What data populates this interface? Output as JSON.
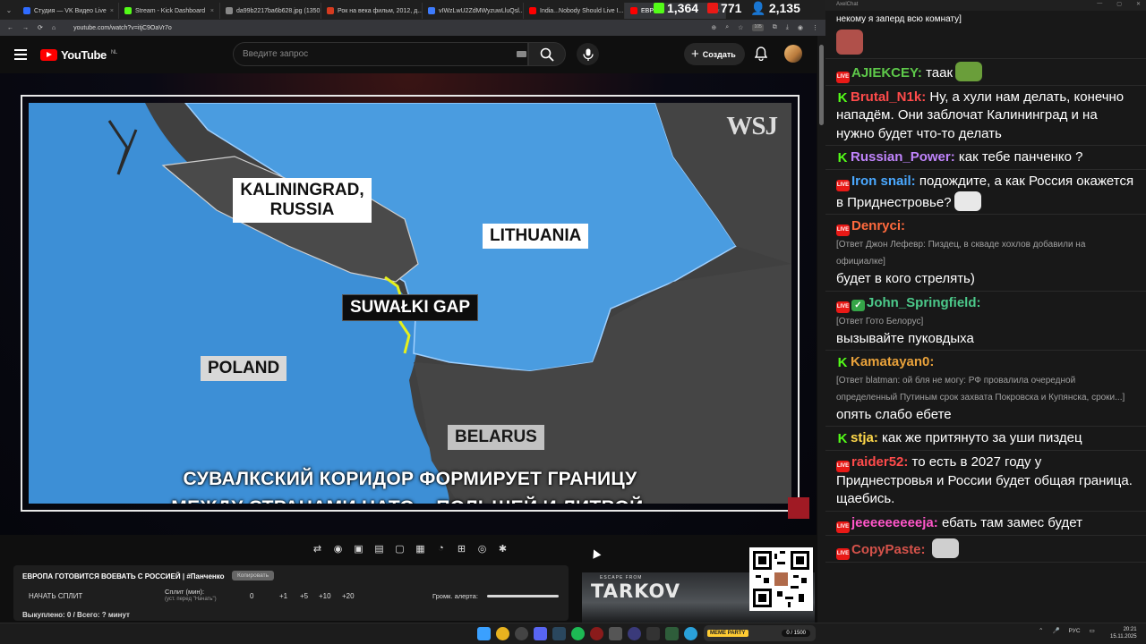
{
  "browser": {
    "tabs": [
      {
        "title": "Студия — VK Видео Live",
        "favcolor": "#2f6bff"
      },
      {
        "title": "Stream - Kick Dashboard",
        "favcolor": "#53fc18"
      },
      {
        "title": "da99b2217ba6b628.jpg (1350...",
        "favcolor": "#888888"
      },
      {
        "title": "Рок на века фильм, 2012, д...",
        "favcolor": "#d63b1f"
      },
      {
        "title": "vIWzLwU2ZdMWyzuwLluQsl...",
        "favcolor": "#3d7bfd"
      },
      {
        "title": "India...Nobody Should Live I...",
        "favcolor": "#ff0000"
      },
      {
        "title": "ЕВРО",
        "favcolor": "#ff0000"
      }
    ],
    "url": "youtube.com/watch?v=itjC9OaVr7o",
    "ext_badge": "105"
  },
  "counters": {
    "kick": "1,364",
    "vk": "771",
    "users": "2,135"
  },
  "youtube": {
    "logo_text": "YouTube",
    "region": "NL",
    "search_placeholder": "Введите запрос",
    "create_label": "Создать"
  },
  "video": {
    "watermark": "WSJ",
    "labels": {
      "kaliningrad": "KALININGRAD,\nRUSSIA",
      "lithuania": "LITHUANIA",
      "suwalki": "SUWAŁKI GAP",
      "poland": "POLAND",
      "belarus": "BELARUS"
    },
    "subtitle_line1": "СУВАЛКСКИЙ КОРИДОР ФОРМИРУЕТ ГРАНИЦУ",
    "subtitle_line2": "МЕЖДУ СТРАНАМИ НАТО – ПОЛЬШЕЙ И ЛИТВОЙ,"
  },
  "split": {
    "title": "ЕВРОПА ГОТОВИТСЯ ВОЕВАТЬ С РОССИЕЙ | #Панченко",
    "copy_label": "Копировать",
    "start_label": "НАЧАТЬ СПЛИТ",
    "split_label": "Сплит (мин):",
    "split_hint": "(уст. перед \"Начать\")",
    "value": "0",
    "increments": [
      "+1",
      "+5",
      "+10",
      "+20"
    ],
    "alert_label": "Громк. алерта:",
    "bought": "Выкуплено: 0 / Всего: ? минут"
  },
  "ad": {
    "subtitle": "ESCAPE FROM",
    "title": "TARKOV"
  },
  "taskbar": {
    "party_label": "MEME PARTY",
    "party_stat": "0 / 1500",
    "lang": "РУС",
    "time": "20:21",
    "date": "15.11.2025"
  },
  "chat": {
    "window_title": "AxelChat",
    "messages": [
      {
        "platform": "none",
        "user": "",
        "color": "#ffffff",
        "reply": "",
        "text": "некому я заперд всю комнату]",
        "emote": ""
      },
      {
        "platform": "none",
        "user": "",
        "color": "#ffffff",
        "reply": "",
        "text": "",
        "emote": "avatar"
      },
      {
        "platform": "vk",
        "user": "AJIEKCEY:",
        "color": "#5ec94a",
        "reply": "",
        "text": "таак",
        "emote": "frog"
      },
      {
        "platform": "kick",
        "user": "Brutal_N1k:",
        "color": "#ff4b4b",
        "reply": "",
        "text": "Ну, а хули нам делать, конечно нападём. Они заблочат Калининград и на нужно будет что-то делать",
        "emote": ""
      },
      {
        "platform": "kick",
        "user": "Russian_Power:",
        "color": "#c084fc",
        "reply": "",
        "text": "как тебе панченко ?",
        "emote": ""
      },
      {
        "platform": "vk",
        "user": "Iron snail:",
        "color": "#4aa8ff",
        "reply": "",
        "text": "подождите, а как Россия окажется в Приднестровье?",
        "emote": "pepe"
      },
      {
        "platform": "vk",
        "user": "Denryci:",
        "color": "#ff6a3d",
        "reply": "[Ответ Джон Лефевр: Пиздец, в скваде хохлов добавили на официалке]",
        "text": "будет в кого стрелять)",
        "emote": ""
      },
      {
        "platform": "vk-green",
        "user": "John_Springfield:",
        "color": "#4cc98a",
        "reply": "[Ответ Гото Белорус]",
        "text": "вызывайте пуковдыха",
        "emote": ""
      },
      {
        "platform": "kick",
        "user": "Kamatayan0:",
        "color": "#e9a23b",
        "reply": "[Ответ blatman: ой бля не могу: РФ провалила очередной определенный Путиным срок захвата Покровска и Купянска, сроки...]",
        "text": "опять слабо ебете",
        "emote": ""
      },
      {
        "platform": "kick",
        "user": "stja:",
        "color": "#ffd84a",
        "reply": "",
        "text": "как же притянуто за уши пиздец",
        "emote": ""
      },
      {
        "platform": "vk",
        "user": "raider52:",
        "color": "#ff4b4b",
        "reply": "",
        "text": "то есть в 2027 году у Приднестровья и России будет общая граница. щаебись.",
        "emote": ""
      },
      {
        "platform": "vk",
        "user": "jeeeeeeeeeja:",
        "color": "#ff56c9",
        "reply": "",
        "text": "ебать там замес будет",
        "emote": ""
      },
      {
        "platform": "vk",
        "user": "CopyPaste:",
        "color": "#d4524a",
        "reply": "",
        "text": "",
        "emote": "cat"
      }
    ]
  },
  "colors": {
    "accent_red": "#ff0000",
    "kick_green": "#53fc18",
    "vk_red": "#e91916",
    "map_blue": "#3d8fd6",
    "border_yellow": "#e6f01c"
  }
}
